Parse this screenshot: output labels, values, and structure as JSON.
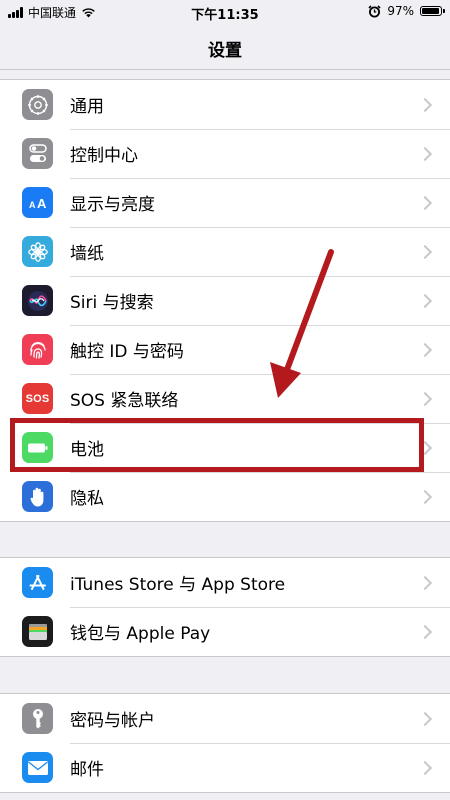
{
  "status_bar": {
    "carrier": "中国联通",
    "time": "下午11:35",
    "battery_text": "97%",
    "battery_level": 0.97
  },
  "nav": {
    "title": "设置"
  },
  "groups": [
    {
      "items": [
        {
          "label": "通用",
          "icon": "gear-icon",
          "color": "#8e8e93"
        },
        {
          "label": "控制中心",
          "icon": "toggles-icon",
          "color": "#8e8e93"
        },
        {
          "label": "显示与亮度",
          "icon": "display-brightness-icon",
          "color": "#1a7cf5"
        },
        {
          "label": "墙纸",
          "icon": "wallpaper-flower-icon",
          "color": "#35aadc"
        },
        {
          "label": "Siri 与搜索",
          "icon": "siri-icon",
          "color": "#1c1c2e"
        },
        {
          "label": "触控 ID 与密码",
          "icon": "fingerprint-icon",
          "color": "#ef3e56"
        },
        {
          "label": "SOS 紧急联络",
          "icon": "sos-icon",
          "color": "#e53935"
        },
        {
          "label": "电池",
          "icon": "battery-icon",
          "color": "#4cd964"
        },
        {
          "label": "隐私",
          "icon": "privacy-hand-icon",
          "color": "#2d6fd8"
        }
      ]
    },
    {
      "items": [
        {
          "label": "iTunes Store 与 App Store",
          "icon": "app-store-icon",
          "color": "#1a8cf0"
        },
        {
          "label": "钱包与 Apple Pay",
          "icon": "wallet-icon",
          "color": "#1c1c1c"
        }
      ]
    },
    {
      "items": [
        {
          "label": "密码与帐户",
          "icon": "key-icon",
          "color": "#8e8e93"
        },
        {
          "label": "邮件",
          "icon": "mail-icon",
          "color": "#1a8cf0"
        }
      ]
    }
  ],
  "colors": {
    "annotation_red": "#b3191d",
    "background": "#efeff4"
  }
}
